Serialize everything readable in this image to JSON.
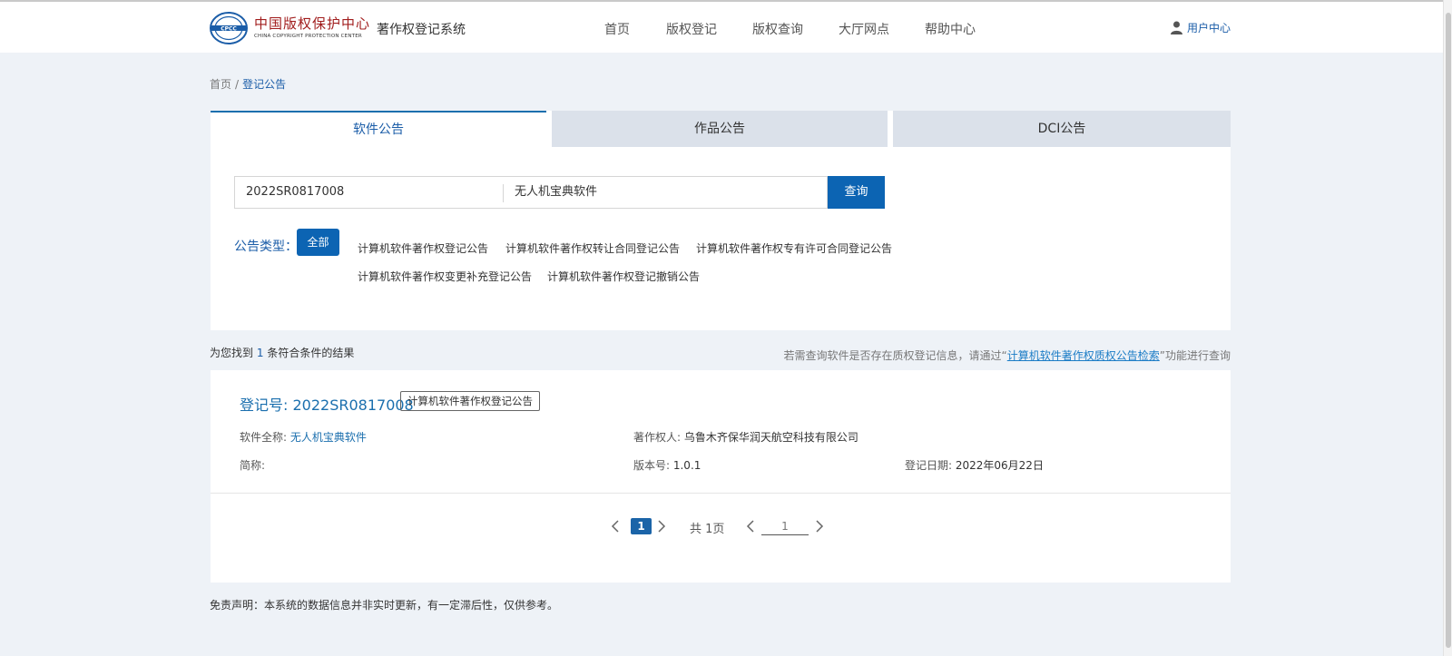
{
  "header": {
    "logo_cn": "中国版权保护中心",
    "logo_en": "CHINA COPYRIGHT PROTECTION CENTER",
    "system_title": "著作权登记系统",
    "nav": [
      "首页",
      "版权登记",
      "版权查询",
      "大厅网点",
      "帮助中心"
    ],
    "user_center": "用户中心"
  },
  "breadcrumb": {
    "home": "首页",
    "separator": "/",
    "current": "登记公告"
  },
  "tabs": [
    {
      "label": "软件公告",
      "active": true
    },
    {
      "label": "作品公告",
      "active": false
    },
    {
      "label": "DCI公告",
      "active": false
    }
  ],
  "search": {
    "reg_number": "2022SR0817008",
    "software_name": "无人机宝典软件",
    "button": "查询"
  },
  "filter": {
    "label": "公告类型：",
    "all": "全部",
    "types": [
      "计算机软件著作权登记公告",
      "计算机软件著作权转让合同登记公告",
      "计算机软件著作权专有许可合同登记公告",
      "计算机软件著作权变更补充登记公告",
      "计算机软件著作权登记撤销公告"
    ]
  },
  "result_summary": {
    "prefix": "为您找到",
    "count": "1",
    "suffix": "条符合条件的结果"
  },
  "hint": {
    "prefix": "若需查询软件是否存在质权登记信息，请通过“",
    "link": "计算机软件著作权质权公告检索",
    "suffix": "”功能进行查询"
  },
  "result": {
    "reg_label": "登记号: ",
    "reg_number": "2022SR0817008",
    "tag": "计算机软件著作权登记公告",
    "full_name_label": "软件全称: ",
    "full_name": "无人机宝典软件",
    "owner_label": "著作权人: ",
    "owner": "乌鲁木齐保华润天航空科技有限公司",
    "short_name_label": "简称:",
    "version_label": "版本号: ",
    "version": "1.0.1",
    "date_label": "登记日期: ",
    "date": "2022年06月22日"
  },
  "pagination": {
    "current": "1",
    "total": "共 1页",
    "jump_value": "1"
  },
  "disclaimer": "免责声明：本系统的数据信息并非实时更新，有一定滞后性，仅供参考。",
  "colors": {
    "primary": "#0c64b3",
    "link": "#1b6fae",
    "background": "#eef2f7",
    "tab_inactive": "#dbe1ea"
  }
}
